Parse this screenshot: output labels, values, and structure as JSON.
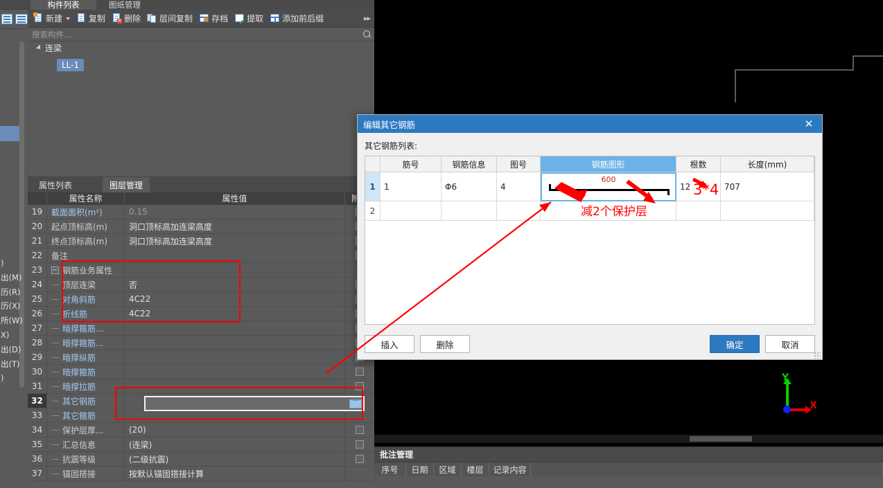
{
  "left_strip": {
    "menu_items": [
      ")",
      "出(M)",
      "历(R)",
      "历(X)",
      "所(W)",
      "X)",
      "",
      "出(D)",
      "出(T)",
      ")"
    ],
    "icons": [
      "list-icon",
      "panel-icon"
    ]
  },
  "component_panel": {
    "tabs": [
      {
        "label": "构件列表",
        "active": true
      },
      {
        "label": "图纸管理",
        "active": false
      }
    ],
    "toolbar": [
      {
        "label": "新建",
        "icon": "new-document-icon",
        "has_caret": true
      },
      {
        "label": "复制",
        "icon": "copy-icon",
        "has_caret": false
      },
      {
        "label": "删除",
        "icon": "delete-icon",
        "has_caret": false
      },
      {
        "label": "层间复制",
        "icon": "layer-copy-icon",
        "has_caret": false
      },
      {
        "label": "存档",
        "icon": "archive-icon",
        "has_caret": false
      },
      {
        "label": "提取",
        "icon": "extract-icon",
        "has_caret": false
      },
      {
        "label": "添加前后缀",
        "icon": "add-prefix-suffix-icon",
        "has_caret": false
      }
    ],
    "toolbar_overflow": "▸▸",
    "search": {
      "placeholder": "搜索构件...",
      "value": "",
      "icon": "search-icon"
    },
    "tree": {
      "group_label": "连梁",
      "selected_item": "LL-1"
    }
  },
  "properties": {
    "tabs": [
      {
        "label": "属性列表",
        "active": false
      },
      {
        "label": "图层管理",
        "active": true
      }
    ],
    "headers": {
      "index": "",
      "name": "属性名称",
      "value": "属性值",
      "extra": "附加"
    },
    "rows": [
      {
        "idx": "19",
        "name": "截面面积(m²)",
        "value": "0.15",
        "blue": true,
        "dim": true,
        "indent": 0,
        "checkbox": true
      },
      {
        "idx": "20",
        "name": "起点顶标高(m)",
        "value": "洞口顶标高加连梁高度",
        "blue": false,
        "dim": false,
        "indent": 0,
        "checkbox": true
      },
      {
        "idx": "21",
        "name": "终点顶标高(m)",
        "value": "洞口顶标高加连梁高度",
        "blue": false,
        "dim": false,
        "indent": 0,
        "checkbox": true
      },
      {
        "idx": "22",
        "name": "备注",
        "value": "",
        "blue": false,
        "dim": false,
        "indent": 0,
        "checkbox": true
      },
      {
        "idx": "23",
        "name": "钢筋业务属性",
        "value": "",
        "blue": false,
        "dim": false,
        "indent": 0,
        "collapse": true,
        "checkbox": false
      },
      {
        "idx": "24",
        "name": "顶层连梁",
        "value": "否",
        "blue": false,
        "dim": false,
        "indent": 1,
        "checkbox": true
      },
      {
        "idx": "25",
        "name": "对角斜筋",
        "value": "4C22",
        "blue": true,
        "dim": false,
        "indent": 1,
        "checkbox": true
      },
      {
        "idx": "26",
        "name": "折线筋",
        "value": "4C22",
        "blue": true,
        "dim": false,
        "indent": 1,
        "checkbox": true
      },
      {
        "idx": "27",
        "name": "暗撑箍筋...",
        "value": "",
        "blue": true,
        "dim": false,
        "indent": 1,
        "checkbox": true
      },
      {
        "idx": "28",
        "name": "暗撑箍筋...",
        "value": "",
        "blue": true,
        "dim": false,
        "indent": 1,
        "checkbox": true
      },
      {
        "idx": "29",
        "name": "暗撑纵筋",
        "value": "",
        "blue": true,
        "dim": false,
        "indent": 1,
        "checkbox": true
      },
      {
        "idx": "30",
        "name": "暗撑箍筋",
        "value": "",
        "blue": true,
        "dim": false,
        "indent": 1,
        "checkbox": true
      },
      {
        "idx": "31",
        "name": "暗撑拉筋",
        "value": "",
        "blue": true,
        "dim": false,
        "indent": 1,
        "checkbox": true
      },
      {
        "idx": "32",
        "name": "其它钢筋",
        "value": "",
        "blue": true,
        "dim": false,
        "indent": 1,
        "checkbox": false,
        "selected": true
      },
      {
        "idx": "33",
        "name": "其它箍筋",
        "value": "",
        "blue": true,
        "dim": false,
        "indent": 1,
        "checkbox": false
      },
      {
        "idx": "34",
        "name": "保护层厚...",
        "value": "(20)",
        "blue": false,
        "dim": false,
        "indent": 1,
        "checkbox": true
      },
      {
        "idx": "35",
        "name": "汇总信息",
        "value": "(连梁)",
        "blue": false,
        "dim": false,
        "indent": 1,
        "checkbox": true
      },
      {
        "idx": "36",
        "name": "抗震等级",
        "value": "(二级抗震)",
        "blue": false,
        "dim": false,
        "indent": 1,
        "checkbox": true
      },
      {
        "idx": "37",
        "name": "锚固搭接",
        "value": "按默认锚固搭接计算",
        "blue": false,
        "dim": false,
        "indent": 1,
        "checkbox": false
      }
    ],
    "edit_cell": {
      "value": "",
      "button_icon": "ellipsis-button"
    }
  },
  "dialog": {
    "title": "编辑其它钢筋",
    "close_icon": "close-icon",
    "list_label": "其它钢筋列表:",
    "table": {
      "headers": [
        "",
        "筋号",
        "钢筋信息",
        "图号",
        "钢筋图形",
        "根数",
        "长度(mm)"
      ],
      "highlight_header": "钢筋图形",
      "rows": [
        {
          "num": "1",
          "bar_no": "1",
          "bar_info": "Φ6",
          "fig_no": "4",
          "shape_dim": "600",
          "count": "12",
          "length": "707"
        },
        {
          "num": "2",
          "bar_no": "",
          "bar_info": "",
          "fig_no": "",
          "shape_dim": "",
          "count": "",
          "length": ""
        }
      ]
    },
    "buttons": {
      "insert": "插入",
      "delete": "删除",
      "ok": "确定",
      "cancel": "取消"
    }
  },
  "annotations": {
    "note_cover": "减2个保护层",
    "note_multiply": "3*4",
    "color": "#ff0000"
  },
  "canvas": {
    "axes": {
      "x_label": "X",
      "y_label": "Y",
      "x_color": "#e00000",
      "y_color": "#00d000",
      "origin_color": "#1020ff"
    }
  },
  "bottom_panel": {
    "title": "批注管理",
    "columns": [
      "序号",
      "日期",
      "区域",
      "楼层",
      "记录内容"
    ]
  }
}
